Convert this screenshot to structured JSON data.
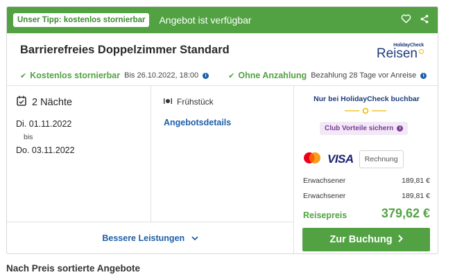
{
  "topbar": {
    "tip_badge": "Unser Tipp: kostenlos stornierbar",
    "availability": "Angebot ist verfügbar",
    "icons": [
      "heart-icon",
      "share-icon"
    ]
  },
  "offer": {
    "room_title": "Barrierefreies Doppelzimmer Standard",
    "logo_top": "HolidayCheck",
    "logo_main": "Reisen",
    "features": [
      {
        "label": "Kostenlos stornierbar",
        "detail": "Bis 26.10.2022, 18:00"
      },
      {
        "label": "Ohne Anzahlung",
        "detail": "Bezahlung 28 Tage vor Anreise"
      }
    ]
  },
  "stay": {
    "nights": "2 Nächte",
    "date_from": "Di. 01.11.2022",
    "bis": "bis",
    "date_to": "Do. 03.11.2022"
  },
  "board": {
    "meal": "Frühstück",
    "details_link": "Angebotsdetails"
  },
  "better_services": "Bessere Leistungen",
  "booking": {
    "only_hc": "Nur bei HolidayCheck buchbar",
    "club": "Club Vorteile sichern",
    "payment": {
      "card1": "mastercard",
      "card2": "VISA",
      "invoice": "Rechnung"
    },
    "prices": [
      {
        "label": "Erwachsener",
        "value": "189,81 €"
      },
      {
        "label": "Erwachsener",
        "value": "189,81 €"
      }
    ],
    "total_label": "Reisepreis",
    "total_value": "379,62 €",
    "book_button": "Zur Buchung",
    "accent_color": "#52a243"
  },
  "section_title": "Nach Preis sortierte Angebote"
}
